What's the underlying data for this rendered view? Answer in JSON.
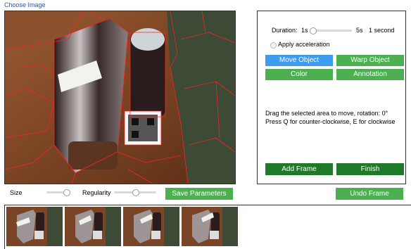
{
  "header": {
    "choose_image_link": "Choose Image"
  },
  "segmentation": {
    "size_label": "Size",
    "regularity_label": "Regularity",
    "size_value": 0.95,
    "regularity_value": 0.5,
    "save_button": "Save Parameters"
  },
  "panel": {
    "duration_label": "Duration:",
    "duration_min": "1s",
    "duration_max": "5s",
    "duration_value_text": "1 second",
    "duration_value": 1,
    "acceleration_label": "Apply acceleration",
    "buttons": {
      "move": "Move Object",
      "warp": "Warp Object",
      "color": "Color",
      "annotation": "Annotation"
    },
    "message_line1": "Drag the selected area to move, rotation: 0°",
    "message_line2": "Press Q for counter-clockwise, E for clockwise",
    "add_frame": "Add Frame",
    "finish": "Finish"
  },
  "undo_frame": "Undo Frame",
  "colors": {
    "green_button": "#4caf50",
    "blue_button": "#3d9bf0",
    "dark_green_button": "#1e7a28",
    "segment_outline": "#ff2020"
  },
  "frames": [
    {
      "icon": "photo-thumbnail"
    },
    {
      "icon": "photo-thumbnail"
    },
    {
      "icon": "photo-thumbnail"
    },
    {
      "icon": "photo-thumbnail"
    }
  ]
}
